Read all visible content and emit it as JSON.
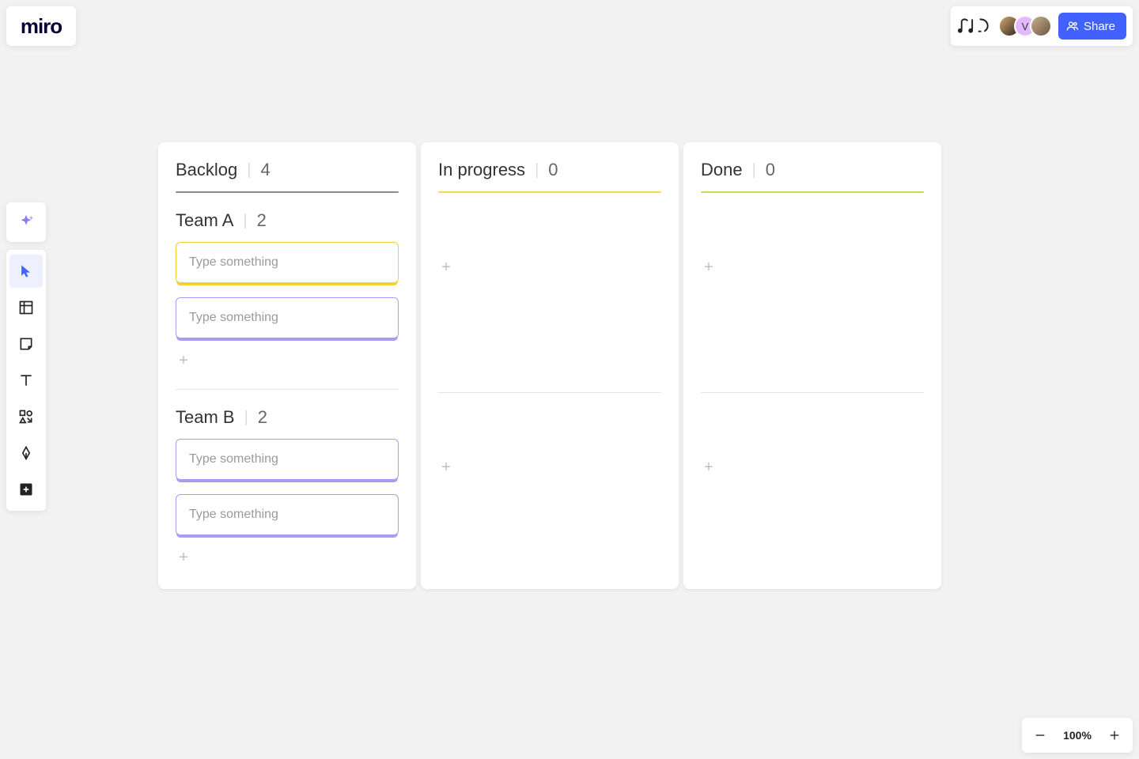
{
  "logo": "miro",
  "share_label": "Share",
  "avatars": [
    {
      "label": ""
    },
    {
      "label": "V"
    },
    {
      "label": ""
    }
  ],
  "zoom": {
    "percent": "100%"
  },
  "board": {
    "columns": [
      {
        "title": "Backlog",
        "count": 4,
        "rule": "gray"
      },
      {
        "title": "In progress",
        "count": 0,
        "rule": "yellow"
      },
      {
        "title": "Done",
        "count": 0,
        "rule": "green"
      }
    ],
    "swimlanes": [
      {
        "name": "Team A",
        "count": 2,
        "cards": [
          {
            "placeholder": "Type something",
            "color": "cyellow"
          },
          {
            "placeholder": "Type something",
            "color": "cpurple"
          }
        ]
      },
      {
        "name": "Team B",
        "count": 2,
        "cards": [
          {
            "placeholder": "Type something",
            "color": "cpurple"
          },
          {
            "placeholder": "Type something",
            "color": "cpurple"
          }
        ]
      }
    ]
  }
}
